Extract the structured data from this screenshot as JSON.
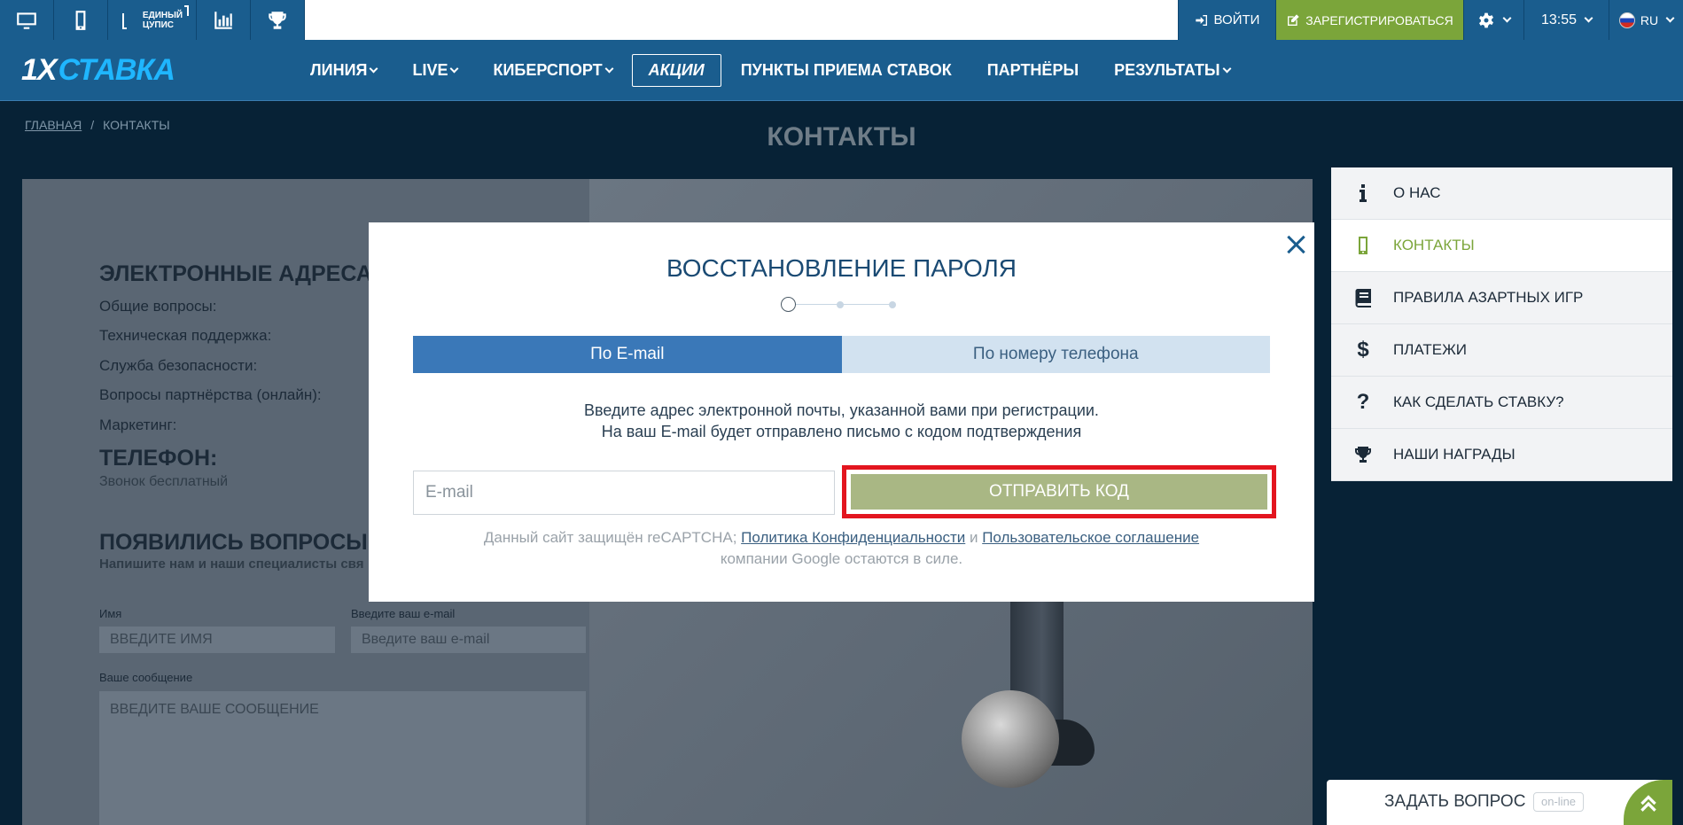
{
  "topbar": {
    "cupis_line1": "ЕДИНЫЙ",
    "cupis_line2": "ЦУПИС",
    "login_label": "ВОЙТИ",
    "register_label": "ЗАРЕГИСТРИРОВАТЬСЯ",
    "time": "13:55",
    "lang": "RU"
  },
  "navbar": {
    "logo_prefix": "1X",
    "logo_suffix": "СТАВКА",
    "items": [
      {
        "label": "ЛИНИЯ"
      },
      {
        "label": "LIVE"
      },
      {
        "label": "КИБЕРСПОРТ"
      },
      {
        "label": "АКЦИИ"
      },
      {
        "label": "ПУНКТЫ ПРИЕМА СТАВОК"
      },
      {
        "label": "ПАРТНЁРЫ"
      },
      {
        "label": "РЕЗУЛЬТАТЫ"
      }
    ]
  },
  "breadcrumb": {
    "home": "ГЛАВНАЯ",
    "separator": "/",
    "current": "КОНТАКТЫ"
  },
  "page_title": "КОНТАКТЫ",
  "contacts": {
    "emails_heading": "ЭЛЕКТРОННЫЕ АДРЕСА:",
    "email_rows": [
      "Общие вопросы:",
      "Техническая поддержка:",
      "Служба безопасности:",
      "Вопросы партнёрства (онлайн):",
      "Маркетинг:"
    ],
    "phone_heading": "ТЕЛЕФОН:",
    "phone_note": "Звонок бесплатный",
    "questions_heading": "ПОЯВИЛИСЬ ВОПРОСЫ И",
    "questions_sub": "Напишите нам и наши специалисты свя",
    "name_label": "Имя",
    "name_placeholder": "ВВЕДИТЕ ИМЯ",
    "email_label": "Введите ваш e-mail",
    "email_placeholder": "Введите ваш e-mail",
    "message_label": "Ваше сообщение",
    "message_placeholder": "ВВЕДИТЕ ВАШЕ СООБЩЕНИЕ"
  },
  "sidebar": {
    "items": [
      {
        "label": "О НАС",
        "icon": "info-icon"
      },
      {
        "label": "КОНТАКТЫ",
        "icon": "mobile-icon"
      },
      {
        "label": "ПРАВИЛА АЗАРТНЫХ ИГР",
        "icon": "book-icon"
      },
      {
        "label": "ПЛАТЕЖИ",
        "icon": "dollar-icon"
      },
      {
        "label": "КАК СДЕЛАТЬ СТАВКУ?",
        "icon": "question-icon"
      },
      {
        "label": "НАШИ НАГРАДЫ",
        "icon": "trophy-icon"
      }
    ]
  },
  "ask_widget": {
    "label": "ЗАДАТЬ ВОПРОС",
    "status": "on-line"
  },
  "modal": {
    "title": "ВОССТАНОВЛЕНИЕ ПАРОЛЯ",
    "tab_email": "По E-mail",
    "tab_phone": "По номеру телефона",
    "message_line1": "Введите адрес электронной почты, указанной вами при регистрации.",
    "message_line2": "На ваш E-mail будет отправлено письмо с кодом подтверждения",
    "email_placeholder": "E-mail",
    "send_button": "ОТПРАВИТЬ КОД",
    "recaptcha_prefix": "Данный сайт защищён reCAPTCHA;",
    "privacy_link": "Политика Конфиденциальности",
    "and_word": "и",
    "terms_link": "Пользовательское соглашение",
    "recaptcha_suffix": "компании Google остаются в силе."
  },
  "colors": {
    "brand_blue": "#1a5d8e",
    "register_green": "#7ba53a",
    "highlight_red": "#e3151f",
    "send_button": "#a9b784"
  }
}
